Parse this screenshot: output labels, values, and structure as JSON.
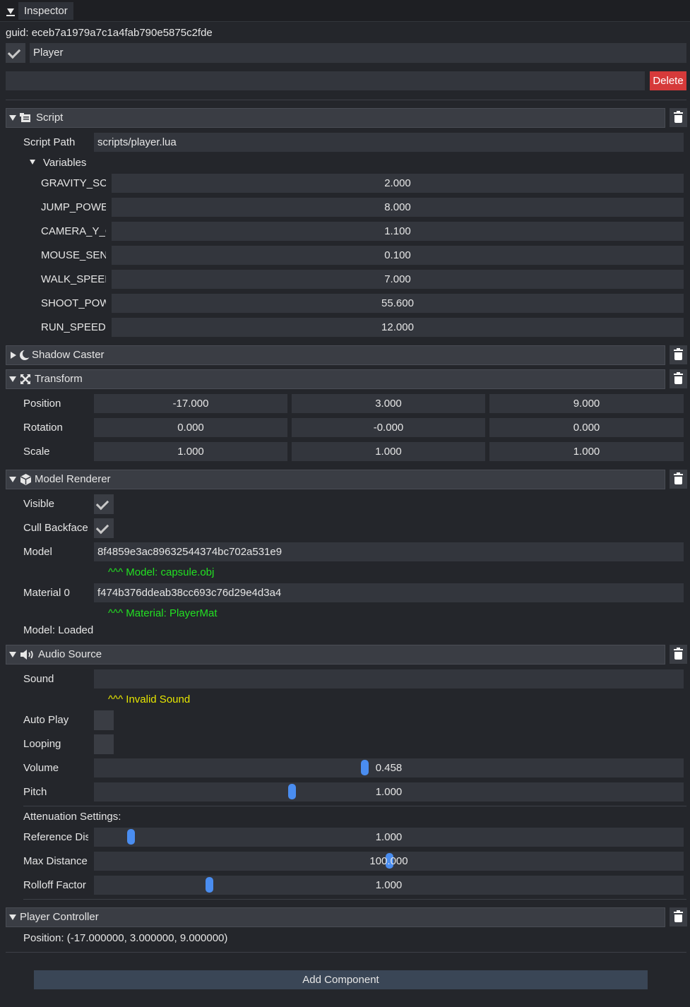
{
  "window": {
    "title": "Inspector"
  },
  "entity": {
    "guid": "guid: eceb7a1979a7c1a4fab790e5875c2fde",
    "name": "Player",
    "enabled": true,
    "delete_label": "Delete",
    "tag_value": ""
  },
  "script": {
    "header": "Script",
    "path_label": "Script Path",
    "path_value": "scripts/player.lua",
    "variables_label": "Variables",
    "variables": [
      {
        "name": "GRAVITY_SCALE",
        "value": "2.000"
      },
      {
        "name": "JUMP_POWER",
        "value": "8.000"
      },
      {
        "name": "CAMERA_Y_OFFSET",
        "value": "1.100"
      },
      {
        "name": "MOUSE_SENSITIVITY",
        "value": "0.100"
      },
      {
        "name": "WALK_SPEED",
        "value": "7.000"
      },
      {
        "name": "SHOOT_POWER",
        "value": "55.600"
      },
      {
        "name": "RUN_SPEED",
        "value": "12.000"
      }
    ]
  },
  "shadow_caster": {
    "header": "Shadow Caster"
  },
  "transform": {
    "header": "Transform",
    "rows": [
      {
        "label": "Position",
        "values": [
          "-17.000",
          "3.000",
          "9.000"
        ]
      },
      {
        "label": "Rotation",
        "values": [
          "0.000",
          "-0.000",
          "0.000"
        ]
      },
      {
        "label": "Scale",
        "values": [
          "1.000",
          "1.000",
          "1.000"
        ]
      }
    ]
  },
  "model_renderer": {
    "header": "Model Renderer",
    "visible_label": "Visible",
    "visible": true,
    "cull_label": "Cull Backface",
    "cull": true,
    "model_label": "Model",
    "model_value": "8f4859e3ac89632544374bc702a531e9",
    "model_hint": "^^^ Model: capsule.obj",
    "material_label": "Material 0",
    "material_value": "f474b376ddeab38cc693c76d29e4d3a4",
    "material_hint": "^^^ Material: PlayerMat",
    "status": "Model: Loaded"
  },
  "audio_source": {
    "header": "Audio Source",
    "sound_label": "Sound",
    "sound_value": "",
    "sound_hint": "^^^ Invalid Sound",
    "autoplay_label": "Auto Play",
    "autoplay": false,
    "looping_label": "Looping",
    "looping": false,
    "volume_label": "Volume",
    "volume_value": "0.458",
    "volume_fraction": 0.458,
    "pitch_label": "Pitch",
    "pitch_value": "1.000",
    "pitch_fraction": 0.333,
    "attenuation_label": "Attenuation Settings:",
    "ref_label": "Reference Distance",
    "ref_value": "1.000",
    "ref_fraction": 0.055,
    "max_label": "Max Distance",
    "max_value": "100.000",
    "max_fraction": 0.5,
    "rolloff_label": "Rolloff Factor",
    "rolloff_value": "1.000",
    "rolloff_fraction": 0.19
  },
  "player_controller": {
    "header": "Player Controller",
    "position_text": "Position: (-17.000000, 3.000000, 9.000000)"
  },
  "add_component_label": "Add Component",
  "colors": {
    "accent": "#4a8df0",
    "delete": "#d63a3a",
    "ok_hint": "#22e022",
    "warn_hint": "#e6e600"
  }
}
